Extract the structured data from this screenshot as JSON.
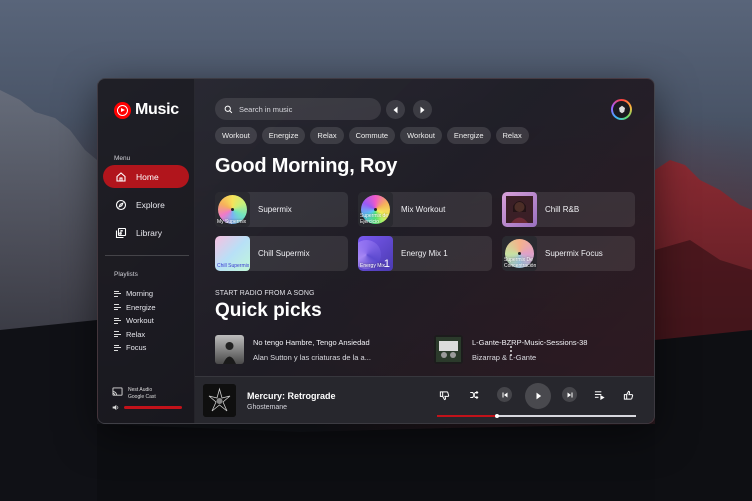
{
  "app": {
    "title": "Music"
  },
  "sidebar": {
    "menu_label": "Menu",
    "nav": [
      {
        "label": "Home",
        "icon": "home-icon",
        "active": true
      },
      {
        "label": "Explore",
        "icon": "compass-icon",
        "active": false
      },
      {
        "label": "Library",
        "icon": "library-icon",
        "active": false
      }
    ],
    "playlists_label": "Playlists",
    "playlists": [
      "Morning",
      "Energize",
      "Workout",
      "Relax",
      "Focus"
    ],
    "cast": {
      "line1": "Nest Audio",
      "line2": "Google Cast"
    },
    "volume_level": 0.75
  },
  "search": {
    "placeholder": "Search in music"
  },
  "chips": [
    "Workout",
    "Energize",
    "Relax",
    "Commute",
    "Workout",
    "Energize",
    "Relax"
  ],
  "greeting": "Good Morning, Roy",
  "mixes": [
    {
      "label": "Supermix",
      "art_caption": "My Supermix"
    },
    {
      "label": "Mix Workout",
      "art_caption": "Supermix de Ejercicio"
    },
    {
      "label": "Chill R&B",
      "art_caption": ""
    },
    {
      "label": "Chill Supermix",
      "art_caption": "Chill Supermix"
    },
    {
      "label": "Energy Mix 1",
      "art_caption": "Energy Mix"
    },
    {
      "label": "Supermix Focus",
      "art_caption": "Supermix De Concentración"
    }
  ],
  "energy_mix_number": "1",
  "quick_picks": {
    "eyebrow": "START RADIO FROM A SONG",
    "title": "Quick picks",
    "items": [
      {
        "title": "No tengo Hambre, Tengo Ansiedad",
        "artist": "Alan Sutton y las criaturas de la a..."
      },
      {
        "title": "L-Gante-BZRP-Music-Sessions-38",
        "artist": "Bizarrap & L-Gante"
      }
    ]
  },
  "player": {
    "title": "Mercury: Retrograde",
    "artist": "Ghostemane",
    "progress": 0.3
  },
  "colors": {
    "accent": "#c2121a",
    "active_nav": "#b1151c",
    "logo": "#ff0000"
  }
}
